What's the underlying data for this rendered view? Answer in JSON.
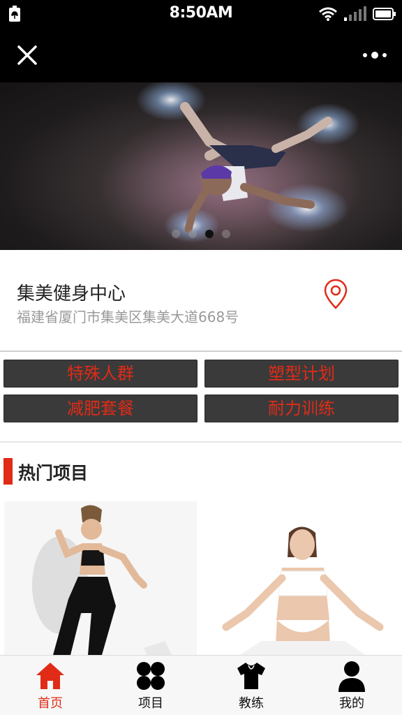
{
  "status_bar": {
    "time": "8:50AM"
  },
  "nav": {
    "close_icon": "close-icon",
    "more_icon": "more-icon"
  },
  "banner": {
    "slide_count": 4,
    "active_index": 2
  },
  "venue": {
    "name": "集美健身中心",
    "address": "福建省厦门市集美区集美大道668号",
    "location_icon": "location-pin-icon"
  },
  "categories": [
    "特殊人群",
    "塑型计划",
    "减肥套餐",
    "耐力训练"
  ],
  "section": {
    "title": "热门项目"
  },
  "tabs": [
    {
      "label": "首页",
      "icon": "home-icon",
      "active": true
    },
    {
      "label": "项目",
      "icon": "grid-icon",
      "active": false
    },
    {
      "label": "教练",
      "icon": "shirt-icon",
      "active": false
    },
    {
      "label": "我的",
      "icon": "user-icon",
      "active": false
    }
  ],
  "colors": {
    "accent": "#e02b17",
    "button_bg": "#3a3a3a",
    "topbar": "#000000"
  }
}
